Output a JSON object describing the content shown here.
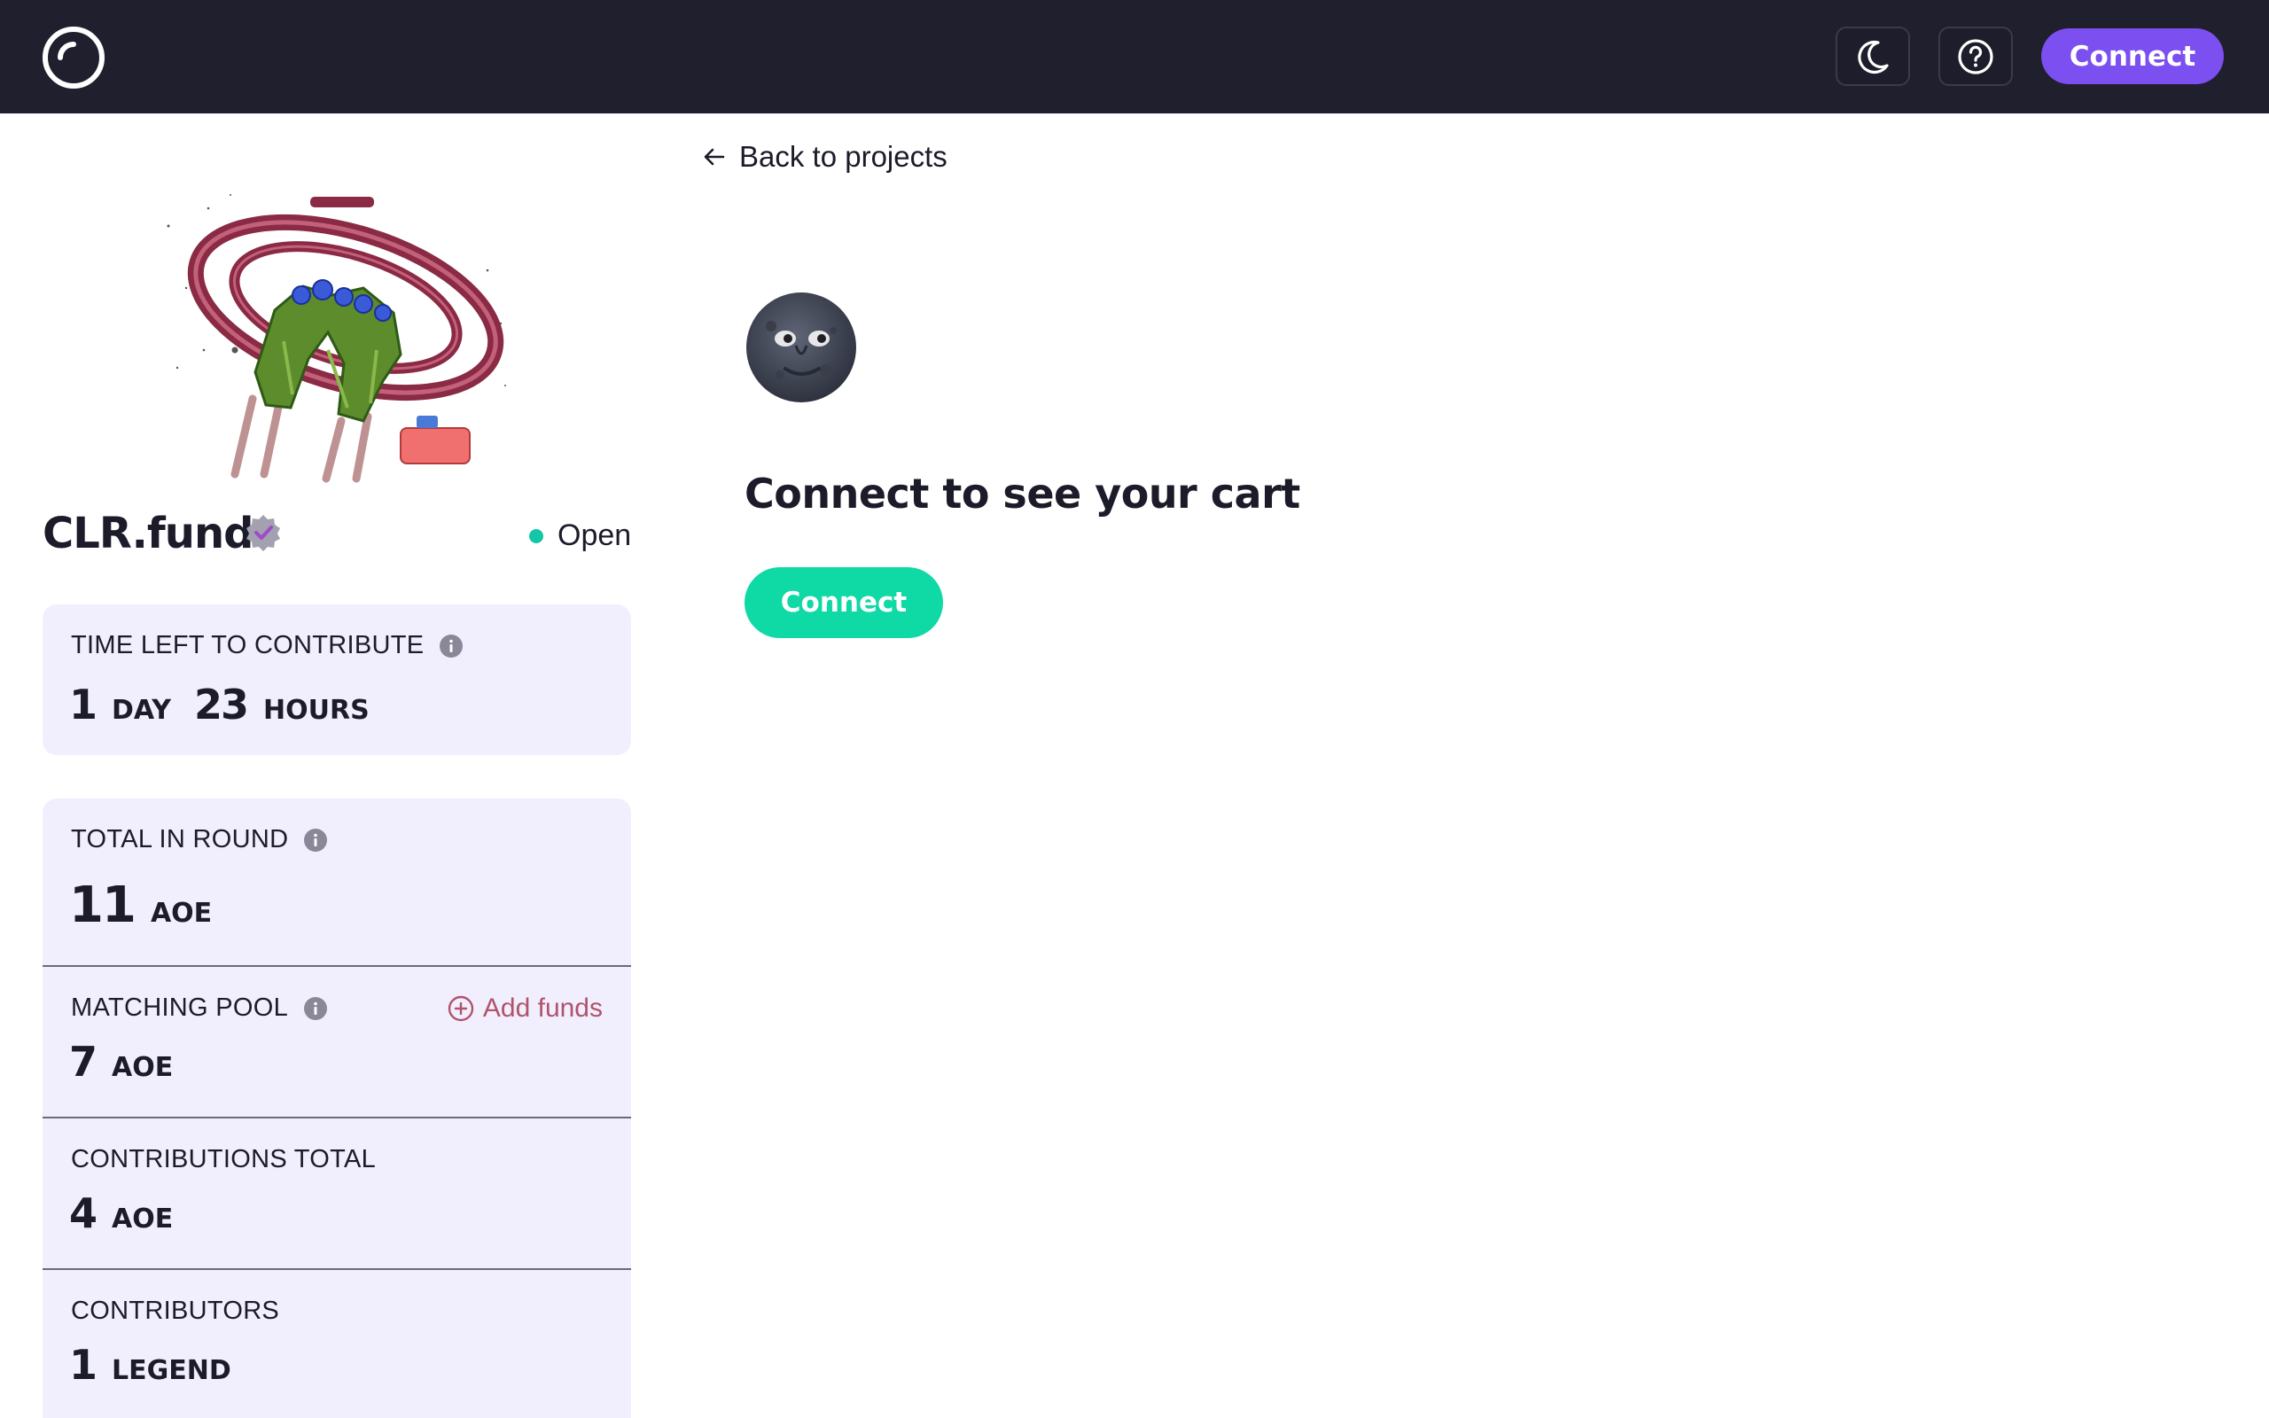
{
  "header": {
    "logo_icon": "clr-fund-logo-icon",
    "theme_icon": "moon-icon",
    "help_icon": "help-circle-icon",
    "connect_label": "Connect",
    "accent": "#7b4ff0"
  },
  "sidebar": {
    "round_name": "CLR.fund",
    "verified_icon": "verified-badge-icon",
    "status_label": "Open",
    "status_color": "#14c6a8",
    "time_left": {
      "label": "TIME LEFT TO CONTRIBUTE",
      "days": "1",
      "days_unit": "DAY",
      "hours": "23",
      "hours_unit": "HOURS"
    },
    "total_in_round": {
      "label": "TOTAL IN ROUND",
      "value": "11",
      "unit": "AOE"
    },
    "matching_pool": {
      "label": "MATCHING POOL",
      "value": "7",
      "unit": "AOE",
      "add_funds_label": "Add funds"
    },
    "contributions_total": {
      "label": "CONTRIBUTIONS TOTAL",
      "value": "4",
      "unit": "AOE"
    },
    "contributors": {
      "label": "CONTRIBUTORS",
      "value": "1",
      "unit": "LEGEND"
    }
  },
  "main": {
    "back_label": "Back to projects",
    "cart_title": "Connect to see your cart",
    "connect_label": "Connect",
    "connect_color": "#0fd9a4"
  }
}
